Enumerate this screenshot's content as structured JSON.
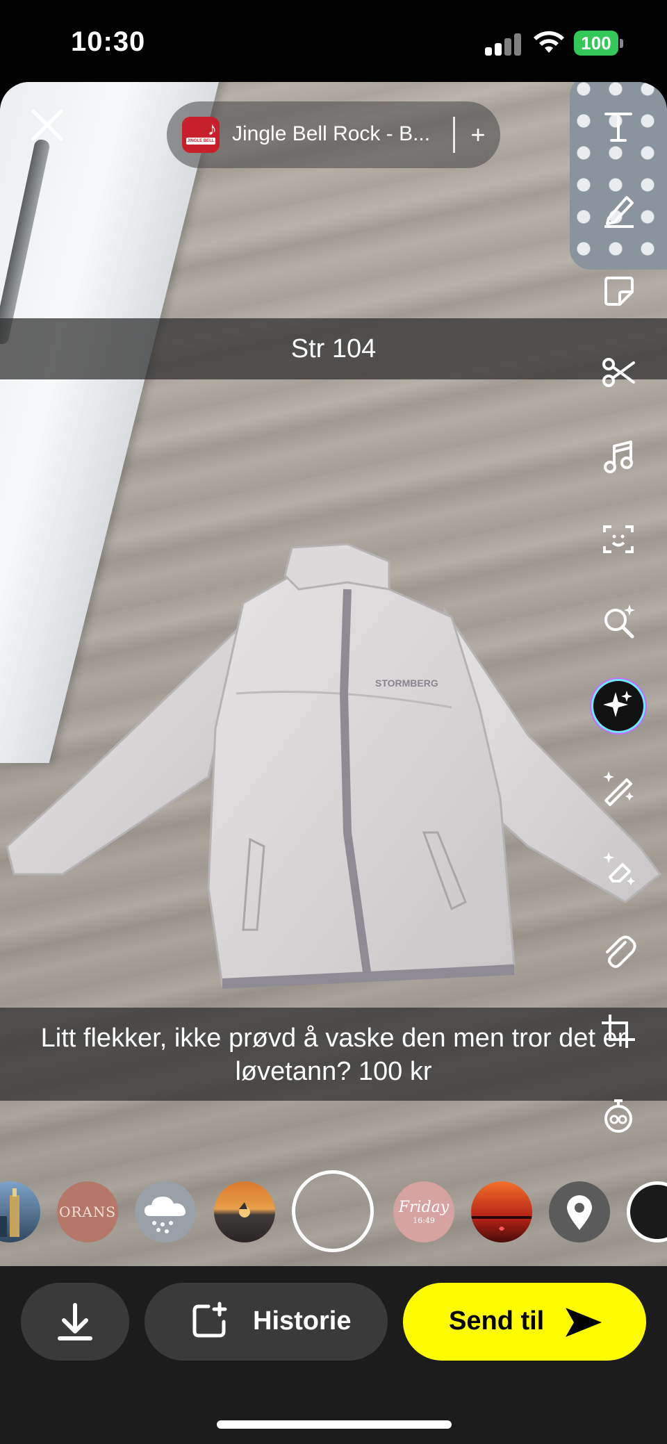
{
  "status_bar": {
    "time": "10:30",
    "battery": "100",
    "battery_color": "#34c759"
  },
  "music": {
    "title": "Jingle Bell Rock - B...",
    "add_label": "+",
    "art_text": "JINGLE BELL ROCK"
  },
  "captions": {
    "size": "Str 104",
    "description": "Litt flekker, ikke prøvd å vaske den men tror det er løvetann? 100 kr"
  },
  "jacket": {
    "brand_text": "STORMBERG"
  },
  "toolbar": {
    "tools": [
      "text-icon",
      "pencil-icon",
      "sticker-icon",
      "scissors-icon",
      "music-note-icon",
      "scan-icon",
      "search-sparkle-icon",
      "ai-sparkle-icon",
      "magic-wand-icon",
      "eraser-sparkle-icon",
      "paperclip-icon",
      "crop-icon",
      "timer-icon"
    ]
  },
  "lenses": {
    "items": [
      {
        "name": "lens-city",
        "label": ""
      },
      {
        "name": "lens-orange",
        "label": "ORANS"
      },
      {
        "name": "lens-weather",
        "label": ""
      },
      {
        "name": "lens-sunset",
        "label": ""
      },
      {
        "name": "lens-friday",
        "label": "Friday",
        "sub": "16:49"
      },
      {
        "name": "lens-lake",
        "label": ""
      },
      {
        "name": "lens-location",
        "label": ""
      }
    ]
  },
  "bottom": {
    "save_label": "",
    "story_label": "Historie",
    "send_label": "Send til",
    "send_color": "#fffc00"
  }
}
